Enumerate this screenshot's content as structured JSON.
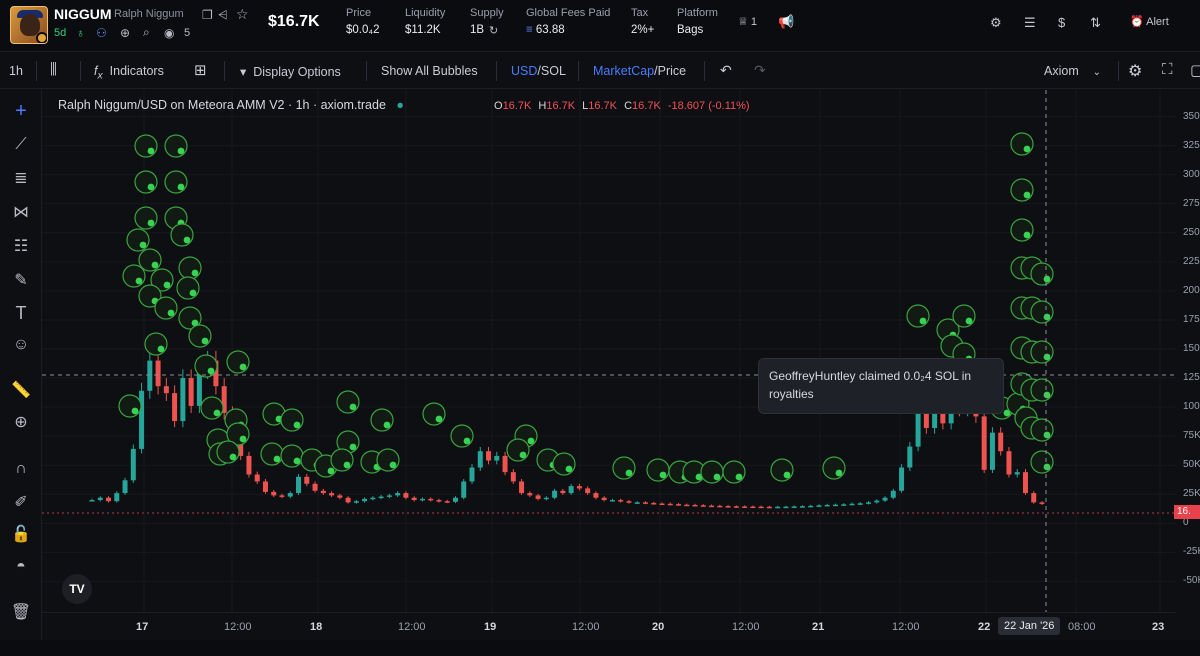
{
  "header": {
    "ticker": "NIGGUM",
    "token_name": "Ralph Niggum",
    "age": "5d",
    "holders": "5",
    "market_cap": "$16.7K",
    "stats": [
      {
        "label": "Price",
        "value": "$0.0₄2"
      },
      {
        "label": "Liquidity",
        "value": "$11.2K"
      },
      {
        "label": "Supply",
        "value": "1B"
      },
      {
        "label": "Global Fees Paid",
        "value": "63.88"
      },
      {
        "label": "Tax",
        "value": "2%+"
      },
      {
        "label": "Platform",
        "value": "Bags"
      }
    ],
    "dev_count": "1",
    "alert_label": "Alert"
  },
  "toolbar": {
    "interval": "1h",
    "indicators": "Indicators",
    "display_options": "Display Options",
    "show_all_bubbles": "Show All Bubbles",
    "currency_active": "USD",
    "currency_inactive": "/SOL",
    "mode_active": "MarketCap",
    "mode_inactive": "/Price",
    "source": "Axiom"
  },
  "chart": {
    "legend": "Ralph Niggum/USD on Meteora AMM V2 · 1h · axiom.trade",
    "ohlc": {
      "o": "16.7K",
      "h": "16.7K",
      "l": "16.7K",
      "c": "16.7K",
      "change": "-18.607 (-0.11%)"
    },
    "tooltip": "GeoffreyHuntley claimed 0.0₂4 SOL in royalties",
    "logo": "TV",
    "last_price": "16."
  },
  "colors": {
    "up": "#26a69a",
    "down": "#ef5350",
    "bubble": "#39d353",
    "accent": "#4b7bff"
  },
  "chart_data": {
    "type": "candlestick",
    "y_ticks": [
      "350K",
      "325K",
      "300K",
      "275K",
      "250K",
      "225K",
      "200K",
      "175K",
      "150K",
      "125K",
      "100K",
      "75K",
      "50K",
      "25K",
      "0",
      "-25K",
      "-50K"
    ],
    "ylim": [
      -60000,
      360000
    ],
    "x_ticks": [
      "17",
      "12:00",
      "18",
      "12:00",
      "19",
      "12:00",
      "20",
      "12:00",
      "21",
      "12:00",
      "22",
      "08:00",
      "23"
    ],
    "x_cursor": "22 Jan '26",
    "series": [
      {
        "name": "NIGGUM/USD",
        "close": [
          20000,
          22000,
          19000,
          26000,
          37000,
          64000,
          114000,
          140000,
          118000,
          112000,
          88000,
          125000,
          101000,
          132000,
          140000,
          118000,
          95000,
          70000,
          58000,
          42000,
          36000,
          27000,
          24000,
          23000,
          26000,
          40000,
          34000,
          28000,
          26000,
          24000,
          22000,
          18000,
          19000,
          21000,
          22000,
          23000,
          24000,
          26000,
          22000,
          20000,
          21000,
          20000,
          19000,
          18500,
          22000,
          36000,
          48000,
          62000,
          54000,
          58000,
          44000,
          36000,
          26000,
          24000,
          21000,
          22000,
          28000,
          26000,
          32000,
          30000,
          26000,
          22000,
          20000,
          20000,
          19000,
          18000,
          18000,
          17500,
          17000,
          16800,
          16500,
          16000,
          15800,
          15500,
          15200,
          15000,
          14800,
          14600,
          14500,
          14400,
          14300,
          14200,
          14100,
          14200,
          14300,
          14500,
          14700,
          15000,
          15400,
          15800,
          16000,
          16300,
          16800,
          17200,
          18000,
          19500,
          22000,
          28000,
          48000,
          66000,
          128000,
          82000,
          114000,
          86000,
          122000,
          98000,
          124000,
          92000,
          46000,
          78000,
          62000,
          42000,
          44000,
          26000,
          18000,
          16700
        ]
      }
    ],
    "bubbles": "green trade bubbles clustered around 17 Jan, 18–20 Jan and 22 Jan"
  }
}
